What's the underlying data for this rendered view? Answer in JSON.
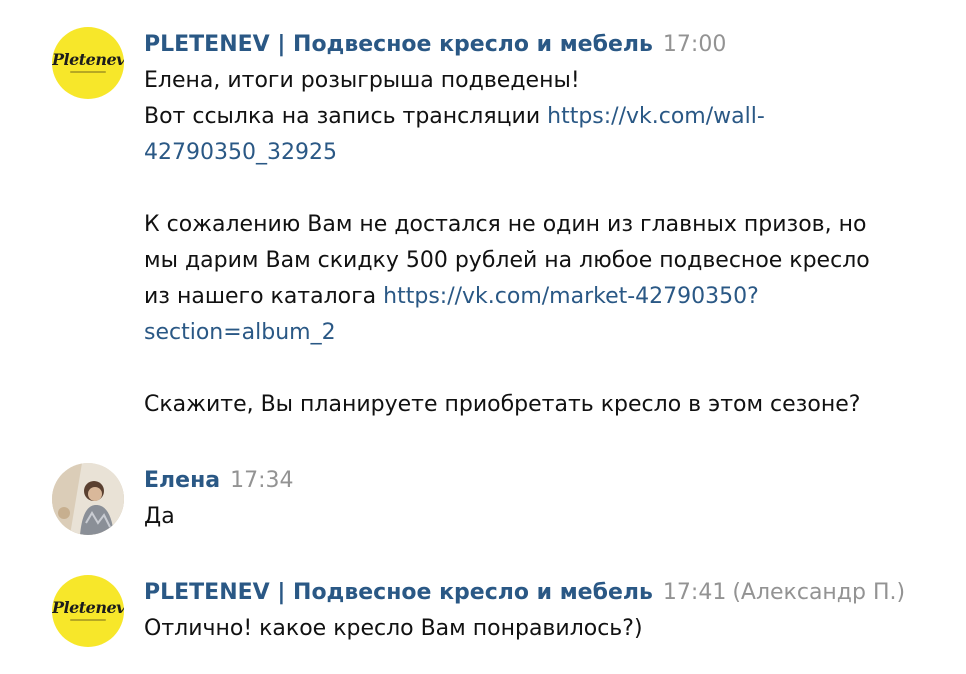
{
  "messages": [
    {
      "author": "PLETENEV | Подвесное кресло и мебель",
      "time": "17:00",
      "avatar_text": "Pletenev",
      "lines": {
        "l1": "Елена, итоги розыгрыша подведены!",
        "l2_text": "Вот ссылка на запись трансляции ",
        "l2_link": "https://vk.com/wall-",
        "l3_link": "42790350_32925",
        "l5": "К сожалению Вам не достался не один из главных призов, но",
        "l6": "мы дарим Вам скидку 500 рублей на любое подвесное кресло",
        "l7_text": "из нашего каталога ",
        "l7_link": "https://vk.com/market-42790350?",
        "l8_link": "section=album_2",
        "l10": "Скажите, Вы планируете приобретать кресло в этом сезоне?"
      }
    },
    {
      "author": "Елена",
      "time": "17:34",
      "lines": {
        "l1": "Да"
      }
    },
    {
      "author": "PLETENEV | Подвесное кресло и мебель",
      "time": "17:41",
      "sender_note": "(Александр П.)",
      "avatar_text": "Pletenev",
      "lines": {
        "l1": "Отлично! какое кресло Вам понравилось?)"
      }
    }
  ],
  "colors": {
    "author": "#2a5885",
    "link": "#2a5885",
    "time": "#939393",
    "text": "#111111",
    "logo_bg": "#f7e72a"
  }
}
